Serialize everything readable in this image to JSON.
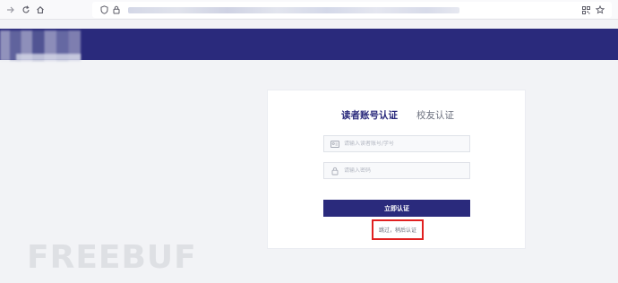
{
  "browser": {
    "back_icon": "arrow-right-icon",
    "reload_icon": "reload-icon",
    "home_icon": "home-icon",
    "shield_icon": "shield-icon",
    "lock_icon": "lock-icon",
    "qr_icon": "qr-code-icon",
    "star_icon": "star-icon"
  },
  "login": {
    "tab_reader": "读者账号认证",
    "tab_alumni": "校友认证",
    "account_placeholder": "请输入读者账号/学号",
    "password_placeholder": "请输入密码",
    "submit_label": "立即认证",
    "skip_label": "跳过，稍后认证"
  },
  "watermark": {
    "text": "FREEBUF"
  },
  "colors": {
    "brand": "#2a2a7c",
    "highlight": "#e02020",
    "background": "#f2f3f6"
  }
}
